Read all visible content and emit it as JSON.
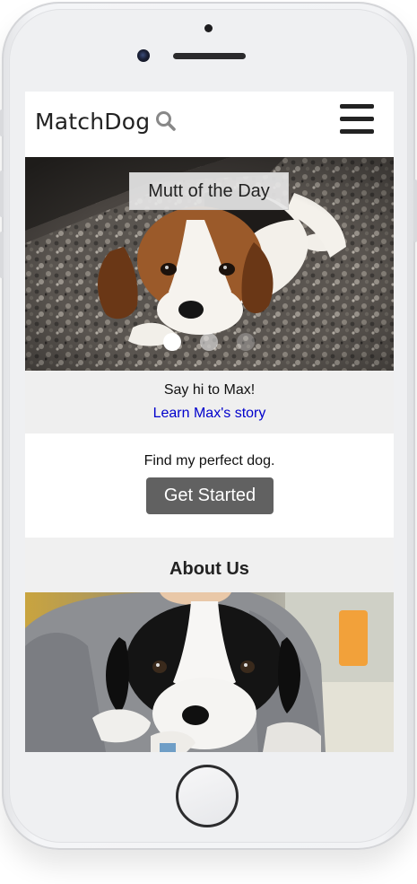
{
  "header": {
    "brand": "MatchDog",
    "search_icon": "search-icon",
    "menu_icon": "hamburger-menu-icon"
  },
  "hero": {
    "title": "Mutt of the Day",
    "photo": "beagle-puppy-photo",
    "slides": 3,
    "active_slide": 1
  },
  "featured": {
    "greeting": "Say hi to Max!",
    "story_link": "Learn Max's story"
  },
  "cta": {
    "prompt": "Find my perfect dog.",
    "button_label": "Get Started"
  },
  "about": {
    "title": "About Us",
    "photo": "puppy-held-photo"
  },
  "colors": {
    "link": "#0000cc",
    "button_bg": "#616161",
    "band_bg": "#efefef"
  }
}
